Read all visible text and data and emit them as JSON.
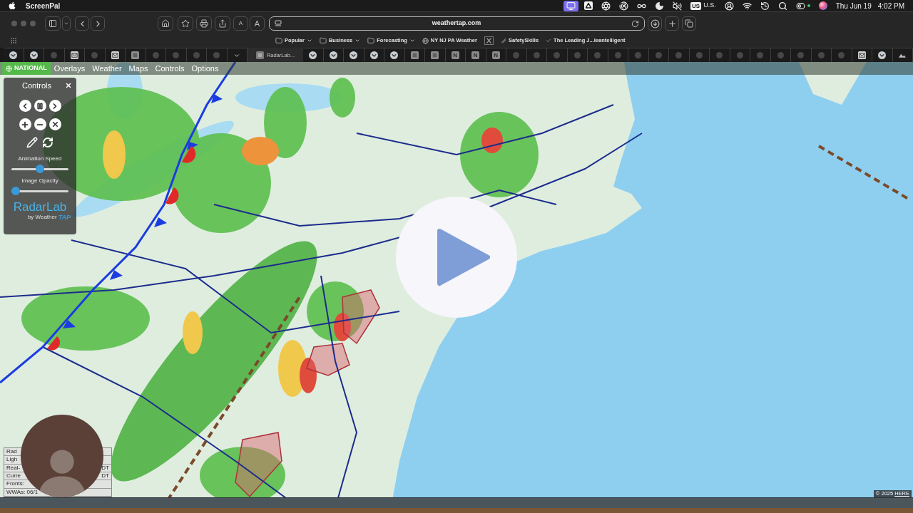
{
  "menu_bar": {
    "app_name": "ScreenPal",
    "status_items": [
      {
        "kind": "monitor",
        "active": true
      },
      {
        "kind": "drive",
        "active": false
      },
      {
        "kind": "aperture",
        "active": false
      },
      {
        "kind": "radar",
        "active": false
      },
      {
        "kind": "infinity",
        "active": false
      },
      {
        "kind": "moon",
        "active": false
      },
      {
        "kind": "mute",
        "active": false
      },
      {
        "kind": "input_source",
        "badge": "US",
        "label": "U.S.",
        "active": false
      },
      {
        "kind": "user",
        "active": false
      },
      {
        "kind": "wifi",
        "active": false
      },
      {
        "kind": "history",
        "active": false
      },
      {
        "kind": "search",
        "active": false
      },
      {
        "kind": "controls",
        "active": false
      },
      {
        "kind": "orb",
        "active": false
      }
    ],
    "date": "Thu Jun 19",
    "time": "4:02 PM"
  },
  "browser": {
    "text_size_buttons": [
      "A",
      "A"
    ],
    "address": "weathertap.com",
    "bookmarks": [
      {
        "kind": "folder",
        "label": "Popular"
      },
      {
        "kind": "folder",
        "label": "Business"
      },
      {
        "kind": "folder",
        "label": "Forecasting"
      },
      {
        "kind": "site",
        "label": "NY NJ PA Weather"
      },
      {
        "kind": "x_logo"
      },
      {
        "kind": "faint",
        "label": "SafetySkills"
      },
      {
        "kind": "check",
        "label": "The Leading J...leantelligent"
      }
    ],
    "tabs": [
      {
        "kind": "emblem",
        "selected": false
      },
      {
        "kind": "emblem",
        "selected": false
      },
      {
        "kind": "faded",
        "selected": false
      },
      {
        "kind": "envelope",
        "selected": false
      },
      {
        "kind": "faded",
        "selected": false
      },
      {
        "kind": "envelope",
        "selected": false
      },
      {
        "kind": "square",
        "selected": false
      },
      {
        "kind": "faded",
        "selected": false
      },
      {
        "kind": "faded",
        "selected": false
      },
      {
        "kind": "faded",
        "selected": false
      },
      {
        "kind": "faded",
        "selected": false
      },
      {
        "kind": "chevron",
        "selected": false
      },
      {
        "kind": "page",
        "title": "RadarLab...",
        "selected": true
      },
      {
        "kind": "emblem",
        "selected": false
      },
      {
        "kind": "emblem",
        "selected": false
      },
      {
        "kind": "emblem",
        "selected": false
      },
      {
        "kind": "emblem",
        "selected": false
      },
      {
        "kind": "emblem",
        "selected": false
      },
      {
        "kind": "square",
        "selected": false
      },
      {
        "kind": "square",
        "selected": false
      },
      {
        "kind": "letter",
        "letter": "N",
        "selected": false
      },
      {
        "kind": "letter",
        "letter": "N",
        "selected": false
      },
      {
        "kind": "letter",
        "letter": "N",
        "selected": false
      },
      {
        "kind": "faded",
        "selected": false
      },
      {
        "kind": "faded",
        "selected": false
      },
      {
        "kind": "faded",
        "selected": false
      },
      {
        "kind": "faded",
        "selected": false
      },
      {
        "kind": "faded",
        "selected": false
      },
      {
        "kind": "faded",
        "selected": false
      },
      {
        "kind": "faded",
        "selected": false
      },
      {
        "kind": "faded",
        "selected": false
      },
      {
        "kind": "faded",
        "selected": false
      },
      {
        "kind": "faded",
        "selected": false
      },
      {
        "kind": "faded",
        "selected": false
      },
      {
        "kind": "faded",
        "selected": false
      },
      {
        "kind": "faded",
        "selected": false
      },
      {
        "kind": "faded",
        "selected": false
      },
      {
        "kind": "faded",
        "selected": false
      },
      {
        "kind": "faded",
        "selected": false
      },
      {
        "kind": "faded",
        "selected": false
      },
      {
        "kind": "envelope",
        "selected": false
      },
      {
        "kind": "emblem",
        "selected": false
      },
      {
        "kind": "landscape",
        "selected": false
      }
    ]
  },
  "map_menu": [
    {
      "kind": "region",
      "label": "NATIONAL",
      "selected": true
    },
    {
      "kind": "menu",
      "label": "Overlays",
      "selected": false
    },
    {
      "kind": "menu",
      "label": "Weather",
      "selected": false
    },
    {
      "kind": "menu",
      "label": "Maps",
      "selected": false
    },
    {
      "kind": "menu",
      "label": "Controls",
      "selected": false
    },
    {
      "kind": "menu",
      "label": "Options",
      "selected": false
    }
  ],
  "controls_panel": {
    "title": "Controls",
    "sliders": [
      {
        "label": "Animation Speed",
        "level": 0.5
      },
      {
        "label": "Image Opacity",
        "level": 0
      }
    ],
    "logo": {
      "name": "RadarLab",
      "byline": "by Weather",
      "brand": "TAP"
    }
  },
  "legend": [
    {
      "text": "Rad"
    },
    {
      "text": "Ligh"
    },
    {
      "text": "Real-",
      "end": "DT"
    },
    {
      "text": "Curre",
      "end": "DT"
    },
    {
      "text": "Fronts:"
    },
    {
      "text": "WWAs: 06/1"
    }
  ],
  "attribution": {
    "text": "© 2025",
    "link": "HERE"
  }
}
